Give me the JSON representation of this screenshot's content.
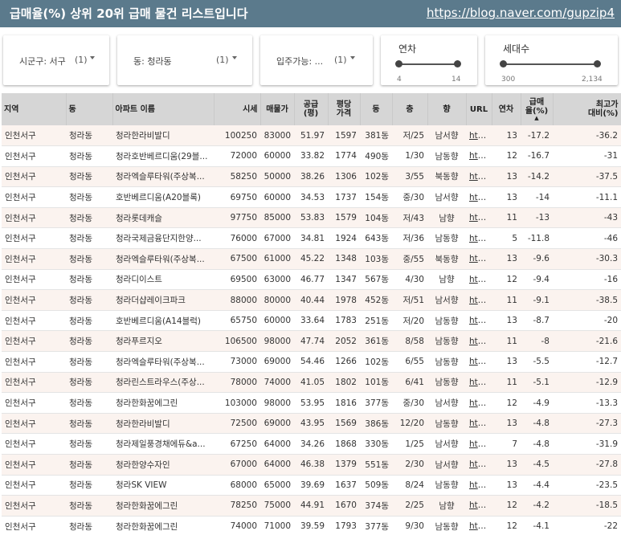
{
  "header": {
    "title": "급매율(%) 상위 20위 급매 물건 리스트입니다",
    "link": "https://blog.naver.com/gupzip4"
  },
  "filters": {
    "district": {
      "label": "시군구: 서구",
      "count": "(1)"
    },
    "dong": {
      "label": "동: 청라동",
      "count": "(1)"
    },
    "movein": {
      "label": "입주가능: ...",
      "count": "(1)"
    }
  },
  "ranges": {
    "year": {
      "label": "연차",
      "min": "4",
      "max": "14"
    },
    "households": {
      "label": "세대수",
      "min": "300",
      "max": "2,134"
    }
  },
  "table": {
    "headers": {
      "region": "지역",
      "dong": "동",
      "apt": "아파트 이름",
      "market": "시세",
      "price": "매물가",
      "area1": "공급",
      "area2": "(평)",
      "ppp1": "평당",
      "ppp2": "가격",
      "bldg": "동",
      "floor": "층",
      "dir": "향",
      "url": "URL",
      "age": "연차",
      "rate1": "급매",
      "rate2": "율(%)",
      "max1": "최고가",
      "max2": "대비(%)"
    },
    "rows": [
      {
        "region": "인천서구",
        "dong": "청라동",
        "apt": "청라한라비발디",
        "market": "100250",
        "price": "83000",
        "area": "51.97",
        "ppp": "1597",
        "bldg": "381동",
        "floor": "저/25",
        "dir": "남서향",
        "url": "htt...",
        "age": "13",
        "rate": "-17.2",
        "max": "-36.2"
      },
      {
        "region": "인천서구",
        "dong": "청라동",
        "apt": "청라호반베르디움(29블...",
        "market": "72000",
        "price": "60000",
        "area": "33.82",
        "ppp": "1774",
        "bldg": "490동",
        "floor": "1/30",
        "dir": "남동향",
        "url": "htt...",
        "age": "12",
        "rate": "-16.7",
        "max": "-31"
      },
      {
        "region": "인천서구",
        "dong": "청라동",
        "apt": "청라엑슬루타워(주상복...",
        "market": "58250",
        "price": "50000",
        "area": "38.26",
        "ppp": "1306",
        "bldg": "102동",
        "floor": "3/55",
        "dir": "북동향",
        "url": "htt...",
        "age": "13",
        "rate": "-14.2",
        "max": "-37.5"
      },
      {
        "region": "인천서구",
        "dong": "청라동",
        "apt": "호반베르디움(A20블록)",
        "market": "69750",
        "price": "60000",
        "area": "34.53",
        "ppp": "1737",
        "bldg": "154동",
        "floor": "중/30",
        "dir": "남서향",
        "url": "htt...",
        "age": "13",
        "rate": "-14",
        "max": "-11.1"
      },
      {
        "region": "인천서구",
        "dong": "청라동",
        "apt": "청라롯데캐슬",
        "market": "97750",
        "price": "85000",
        "area": "53.83",
        "ppp": "1579",
        "bldg": "104동",
        "floor": "저/43",
        "dir": "남향",
        "url": "htt...",
        "age": "11",
        "rate": "-13",
        "max": "-43"
      },
      {
        "region": "인천서구",
        "dong": "청라동",
        "apt": "청라국제금융단지한양...",
        "market": "76000",
        "price": "67000",
        "area": "34.81",
        "ppp": "1924",
        "bldg": "643동",
        "floor": "저/36",
        "dir": "남동향",
        "url": "htt...",
        "age": "5",
        "rate": "-11.8",
        "max": "-46"
      },
      {
        "region": "인천서구",
        "dong": "청라동",
        "apt": "청라엑슬루타워(주상복...",
        "market": "67500",
        "price": "61000",
        "area": "45.22",
        "ppp": "1348",
        "bldg": "103동",
        "floor": "중/55",
        "dir": "북동향",
        "url": "htt...",
        "age": "13",
        "rate": "-9.6",
        "max": "-30.3"
      },
      {
        "region": "인천서구",
        "dong": "청라동",
        "apt": "청라디이스트",
        "market": "69500",
        "price": "63000",
        "area": "46.77",
        "ppp": "1347",
        "bldg": "567동",
        "floor": "4/30",
        "dir": "남향",
        "url": "htt...",
        "age": "12",
        "rate": "-9.4",
        "max": "-16"
      },
      {
        "region": "인천서구",
        "dong": "청라동",
        "apt": "청라더샵레이크파크",
        "market": "88000",
        "price": "80000",
        "area": "40.44",
        "ppp": "1978",
        "bldg": "452동",
        "floor": "저/51",
        "dir": "남서향",
        "url": "htt...",
        "age": "11",
        "rate": "-9.1",
        "max": "-38.5"
      },
      {
        "region": "인천서구",
        "dong": "청라동",
        "apt": "호반베르디움(A14블럭)",
        "market": "65750",
        "price": "60000",
        "area": "33.64",
        "ppp": "1783",
        "bldg": "251동",
        "floor": "저/20",
        "dir": "남동향",
        "url": "htt...",
        "age": "13",
        "rate": "-8.7",
        "max": "-20"
      },
      {
        "region": "인천서구",
        "dong": "청라동",
        "apt": "청라푸르지오",
        "market": "106500",
        "price": "98000",
        "area": "47.74",
        "ppp": "2052",
        "bldg": "361동",
        "floor": "8/58",
        "dir": "남동향",
        "url": "htt...",
        "age": "11",
        "rate": "-8",
        "max": "-21.6"
      },
      {
        "region": "인천서구",
        "dong": "청라동",
        "apt": "청라엑슬루타워(주상복...",
        "market": "73000",
        "price": "69000",
        "area": "54.46",
        "ppp": "1266",
        "bldg": "102동",
        "floor": "6/55",
        "dir": "남동향",
        "url": "htt...",
        "age": "13",
        "rate": "-5.5",
        "max": "-12.7"
      },
      {
        "region": "인천서구",
        "dong": "청라동",
        "apt": "청라린스트라우스(주상...",
        "market": "78000",
        "price": "74000",
        "area": "41.05",
        "ppp": "1802",
        "bldg": "101동",
        "floor": "6/41",
        "dir": "남동향",
        "url": "htt...",
        "age": "11",
        "rate": "-5.1",
        "max": "-12.9"
      },
      {
        "region": "인천서구",
        "dong": "청라동",
        "apt": "청라한화꿈에그린",
        "market": "103000",
        "price": "98000",
        "area": "53.95",
        "ppp": "1816",
        "bldg": "377동",
        "floor": "중/30",
        "dir": "남서향",
        "url": "htt...",
        "age": "12",
        "rate": "-4.9",
        "max": "-13.3"
      },
      {
        "region": "인천서구",
        "dong": "청라동",
        "apt": "청라한라비발디",
        "market": "72500",
        "price": "69000",
        "area": "43.95",
        "ppp": "1569",
        "bldg": "386동",
        "floor": "12/20",
        "dir": "남동향",
        "url": "htt...",
        "age": "13",
        "rate": "-4.8",
        "max": "-27.3"
      },
      {
        "region": "인천서구",
        "dong": "청라동",
        "apt": "청라제일풍경채에듀&a...",
        "market": "67250",
        "price": "64000",
        "area": "34.26",
        "ppp": "1868",
        "bldg": "330동",
        "floor": "1/25",
        "dir": "남서향",
        "url": "htt...",
        "age": "7",
        "rate": "-4.8",
        "max": "-31.9"
      },
      {
        "region": "인천서구",
        "dong": "청라동",
        "apt": "청라한양수자인",
        "market": "67000",
        "price": "64000",
        "area": "46.38",
        "ppp": "1379",
        "bldg": "551동",
        "floor": "2/30",
        "dir": "남서향",
        "url": "htt...",
        "age": "13",
        "rate": "-4.5",
        "max": "-27.8"
      },
      {
        "region": "인천서구",
        "dong": "청라동",
        "apt": "청라SK VIEW",
        "market": "68000",
        "price": "65000",
        "area": "39.69",
        "ppp": "1637",
        "bldg": "509동",
        "floor": "8/24",
        "dir": "남동향",
        "url": "htt...",
        "age": "13",
        "rate": "-4.4",
        "max": "-23.5"
      },
      {
        "region": "인천서구",
        "dong": "청라동",
        "apt": "청라한화꿈에그린",
        "market": "78250",
        "price": "75000",
        "area": "44.91",
        "ppp": "1670",
        "bldg": "374동",
        "floor": "2/25",
        "dir": "남향",
        "url": "htt...",
        "age": "12",
        "rate": "-4.2",
        "max": "-18.5"
      },
      {
        "region": "인천서구",
        "dong": "청라동",
        "apt": "청라한화꿈에그린",
        "market": "74000",
        "price": "71000",
        "area": "39.59",
        "ppp": "1793",
        "bldg": "377동",
        "floor": "9/30",
        "dir": "남동향",
        "url": "htt...",
        "age": "12",
        "rate": "-4.1",
        "max": "-22"
      }
    ]
  }
}
